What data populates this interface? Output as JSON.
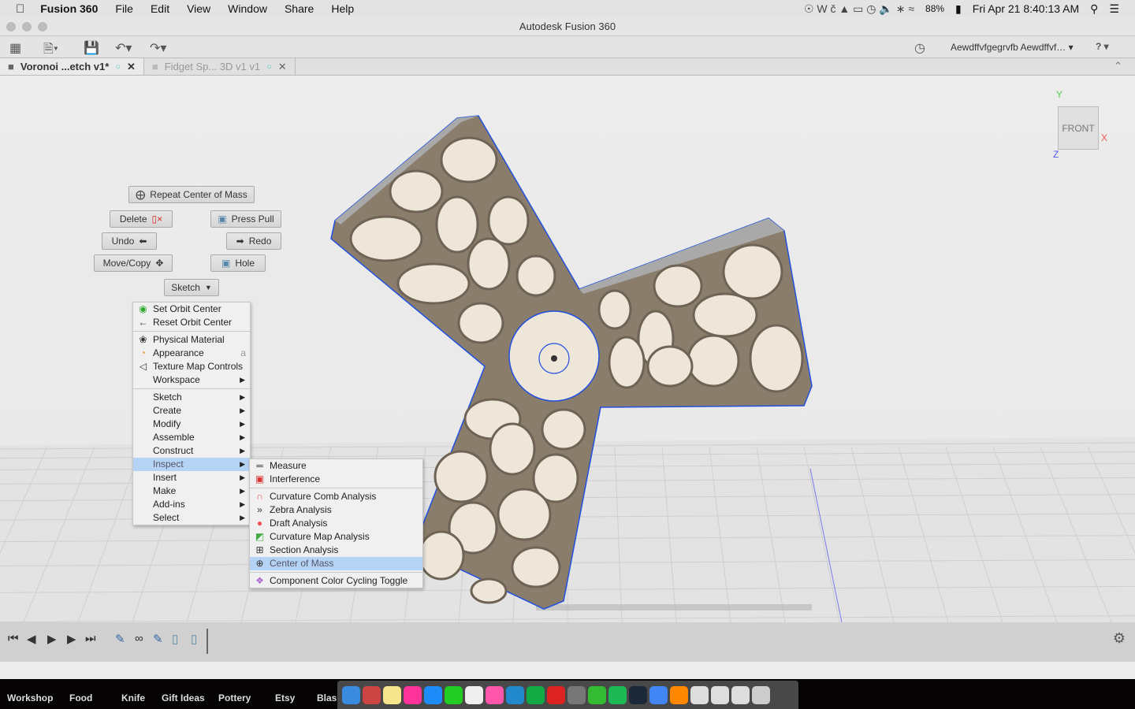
{
  "menubar": {
    "app": "Fusion 360",
    "items": [
      "File",
      "Edit",
      "View",
      "Window",
      "Share",
      "Help"
    ],
    "battery": "88%",
    "clock": "Fri Apr 21  8:40:13 AM"
  },
  "window": {
    "title": "Autodesk Fusion 360",
    "user": "Aewdffvfgegrvfb Aewdffvf… ▾",
    "help": "? ▾"
  },
  "tabs": [
    {
      "label": "Voronoi ...etch v1*",
      "active": true
    },
    {
      "label": "Fidget Sp... 3D v1 v1",
      "active": false
    }
  ],
  "marking_menu": {
    "repeat": "Repeat Center of Mass",
    "delete": "Delete",
    "press_pull": "Press Pull",
    "undo": "Undo",
    "redo": "Redo",
    "move_copy": "Move/Copy",
    "hole": "Hole",
    "sketch": "Sketch"
  },
  "context_menu": {
    "items": [
      {
        "label": "Set Orbit Center",
        "icon": "orbit-center-icon"
      },
      {
        "label": "Reset Orbit Center",
        "icon": "reset-orbit-icon"
      },
      {
        "label": "Physical Material",
        "icon": "material-icon"
      },
      {
        "label": "Appearance",
        "icon": "appearance-icon",
        "shortcut": "a"
      },
      {
        "label": "Texture Map Controls",
        "icon": "texture-icon"
      },
      {
        "label": "Workspace",
        "submenu": true
      },
      {
        "label": "Sketch",
        "submenu": true
      },
      {
        "label": "Create",
        "submenu": true
      },
      {
        "label": "Modify",
        "submenu": true
      },
      {
        "label": "Assemble",
        "submenu": true
      },
      {
        "label": "Construct",
        "submenu": true
      },
      {
        "label": "Inspect",
        "submenu": true,
        "highlighted": true
      },
      {
        "label": "Insert",
        "submenu": true
      },
      {
        "label": "Make",
        "submenu": true
      },
      {
        "label": "Add-ins",
        "submenu": true
      },
      {
        "label": "Select",
        "submenu": true
      }
    ]
  },
  "inspect_submenu": {
    "items": [
      {
        "label": "Measure",
        "icon": "measure-icon"
      },
      {
        "label": "Interference",
        "icon": "interference-icon"
      },
      {
        "label": "Curvature Comb Analysis",
        "icon": "curvature-comb-icon"
      },
      {
        "label": "Zebra Analysis",
        "icon": "zebra-icon"
      },
      {
        "label": "Draft Analysis",
        "icon": "draft-icon"
      },
      {
        "label": "Curvature Map Analysis",
        "icon": "curvature-map-icon"
      },
      {
        "label": "Section Analysis",
        "icon": "section-icon"
      },
      {
        "label": "Center of Mass",
        "icon": "center-of-mass-icon",
        "highlighted": true
      },
      {
        "label": "Component Color Cycling Toggle",
        "icon": "color-cycle-icon"
      }
    ]
  },
  "viewcube": {
    "face": "FRONT",
    "x": "X",
    "y": "Y",
    "z": "Z"
  },
  "bookmarks": [
    "Workshop",
    "Food",
    "Knife",
    "Gift Ideas",
    "Pottery",
    "Etsy",
    "Blas"
  ],
  "colors": {
    "body": "#8b7d6b",
    "hole": "#efe6da",
    "edge": "#2050e0",
    "highlight": "#b5d3f5"
  }
}
